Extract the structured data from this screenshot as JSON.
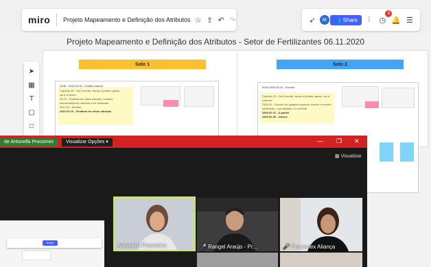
{
  "miro": {
    "logo": "miro",
    "board_title": "Projeto Mapeamento e Definição dos Atributos",
    "share_label": "Share",
    "user_initial": "M",
    "notification_count": "9"
  },
  "board": {
    "heading": "Projeto Mapeamento e Definição dos Atributos  - Setor de Fertilizantes 06.11.2020",
    "solo1": "Solo 1",
    "solo2": "Solo 2",
    "card1_title": "NCM - 2510.20.00 - Fosfato natural",
    "card1_lines": [
      "Capítulo 25 - Sal; enxofre; terras e pedras; gesso,",
      "cal e cimento.",
      "25.10 - Fosfatos de cálcio naturais, fosfatos",
      "aluminocálcicos naturais e cré fosfatado.",
      "2510.20 - Moídos"
    ],
    "card1_bold": "2510.20.10 - Fosfatos de cálcio naturais",
    "card2_title": "NCM 2503.00.10 - Enxofre",
    "card2_lines": [
      "Capítulo 25 - Sal; enxofre; terras e pedras; gesso, cal e",
      "cimento.",
      "2503.00 - Enxofre de qualquer espécie, exceto o enxofre",
      "sublimado, o precipitado e o coloidal."
    ],
    "card2_bold1": "2503.00.10 - A granel",
    "card2_bold2": "2503.00.90 - Outros"
  },
  "zoom": {
    "share_tab": "de  Antonella Procomex",
    "view_options": "Visualizar Opções",
    "view_mode": "Visualizar",
    "participants": [
      "Antonella Procomex",
      "Rangel Araújo - Pr...",
      "Procomex Aliança"
    ]
  },
  "colors": {
    "miro_blue": "#4262ff",
    "zoom_red": "#d32222",
    "active_speaker": "#c8f03c",
    "solo1": "#fbc02d",
    "solo2": "#42a5f5"
  }
}
